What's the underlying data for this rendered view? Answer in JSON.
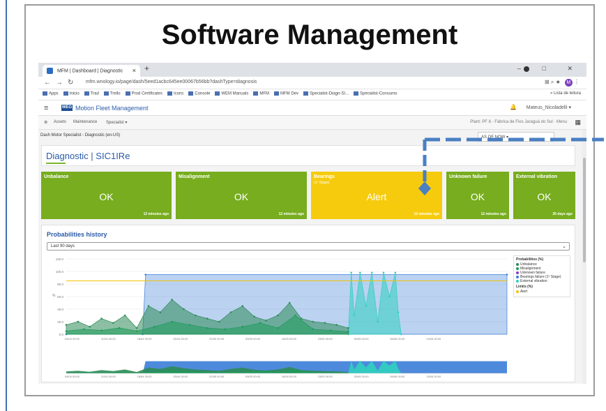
{
  "slide": {
    "title": "Software Management"
  },
  "browser": {
    "tab_title": "MFM | Dashboard | Diagnostic",
    "tab_close": "×",
    "new_tab": "+",
    "window_controls": "–  □  ✕",
    "url": "mfm.wnology.io/page/dash/5eed1acbc645ee00067b56bb?dashType=diagnosis",
    "avatar_letter": "M",
    "bookmarks": [
      "Apps",
      "Inicio",
      "Trad",
      "Trello",
      "Prod Certificates",
      "Icons",
      "Console",
      "WEM Manuals",
      "MFM",
      "MFM Dev",
      "Specialist-Diagn-SI...",
      "Specialist-Consumo"
    ],
    "bookmarks_right": "»  Lista de leitura"
  },
  "app": {
    "logo": "WEG",
    "name": "Motion Fleet Management",
    "user": "Mateus_Nicoladelli",
    "menu": {
      "assets": "Assets",
      "maintenance": "Maintenance",
      "specialist": "Specialist"
    },
    "plant": "Plant:  PF 8 - Fábrica de Fios Jaraguá do Sul  ·  Menu"
  },
  "dashboard": {
    "title": "Dash Motor Specialist - Diagnostic (en-US)",
    "as_of": "AS OF  NOW ▾",
    "heading": "Diagnostic | SIC1IRe"
  },
  "status_cards": [
    {
      "label": "Unbalance",
      "sub": "",
      "value": "OK",
      "ago": "12 minutes ago",
      "color": "#77ad1e"
    },
    {
      "label": "Misalignment",
      "sub": "",
      "value": "OK",
      "ago": "12 minutes ago",
      "color": "#77ad1e"
    },
    {
      "label": "Bearings",
      "sub": "(1º Stage)",
      "value": "Alert",
      "ago": "12 minutes ago",
      "color": "#f6cb0d"
    },
    {
      "label": "Unknown failure",
      "sub": "",
      "value": "OK",
      "ago": "12 minutes ago",
      "color": "#77ad1e"
    },
    {
      "label": "External vibration",
      "sub": "",
      "value": "OK",
      "ago": "26 days ago",
      "color": "#77ad1e"
    }
  ],
  "history": {
    "title": "Probabilities history",
    "range": "Last 90 days",
    "legend_title": "Probabilities (%)",
    "legend_items": [
      {
        "name": "Unbalance",
        "color": "#2e8b57"
      },
      {
        "name": "Misalignment",
        "color": "#1f9a5a"
      },
      {
        "name": "Unknown failure",
        "color": "#7d3fbf"
      },
      {
        "name": "Bearings failure (1º Stage)",
        "color": "#3b7dd8"
      },
      {
        "name": "External vibration",
        "color": "#30d0c0"
      }
    ],
    "limits_title": "Limits (%)",
    "limits_items": [
      {
        "name": "Alert",
        "color": "#f2c200"
      }
    ]
  },
  "chart_data": {
    "type": "area",
    "title": "",
    "ylabel": "%",
    "ylim": [
      0,
      120
    ],
    "yticks": [
      "0.0",
      "20.0",
      "40.0",
      "60.0",
      "80.0",
      "100.0",
      "120.0"
    ],
    "x_ticks": [
      "04/04 00:00",
      "11/04 00:00",
      "18/04 00:00",
      "25/04 00:00",
      "02/05 00:00",
      "09/05 00:00",
      "16/05 00:00",
      "23/05 00:00",
      "30/05 00:00",
      "06/06 00:00",
      "13/06 00:00"
    ],
    "x_range_days": [
      0,
      75
    ],
    "alert_limit": 85,
    "series": [
      {
        "name": "Bearings failure (1º Stage)",
        "color": "#3b7dd8",
        "x": [
          0,
          13,
          13.5,
          75
        ],
        "y": [
          0,
          0,
          95,
          95
        ]
      },
      {
        "name": "External vibration",
        "color": "#30d0c0",
        "x": [
          48,
          48.5,
          49,
          50,
          51,
          52,
          53,
          54,
          55,
          56,
          56.5,
          57
        ],
        "y": [
          0,
          98,
          30,
          98,
          45,
          98,
          20,
          98,
          60,
          98,
          35,
          0
        ]
      },
      {
        "name": "Unbalance",
        "color": "#2e8b57",
        "x": [
          0,
          2,
          4,
          6,
          8,
          10,
          12,
          14,
          16,
          18,
          20,
          22,
          24,
          26,
          28,
          30,
          32,
          34,
          36,
          38,
          40,
          42,
          44,
          46,
          48
        ],
        "y": [
          15,
          20,
          12,
          25,
          18,
          30,
          10,
          45,
          35,
          55,
          40,
          30,
          25,
          20,
          35,
          45,
          28,
          22,
          30,
          50,
          25,
          20,
          18,
          15,
          10
        ]
      },
      {
        "name": "Misalignment",
        "color": "#1f9a5a",
        "x": [
          0,
          3,
          6,
          9,
          12,
          15,
          18,
          21,
          24,
          27,
          30,
          33,
          36,
          39,
          42,
          45,
          48
        ],
        "y": [
          5,
          8,
          6,
          10,
          5,
          12,
          20,
          15,
          10,
          8,
          12,
          18,
          10,
          30,
          8,
          6,
          4
        ]
      }
    ]
  }
}
